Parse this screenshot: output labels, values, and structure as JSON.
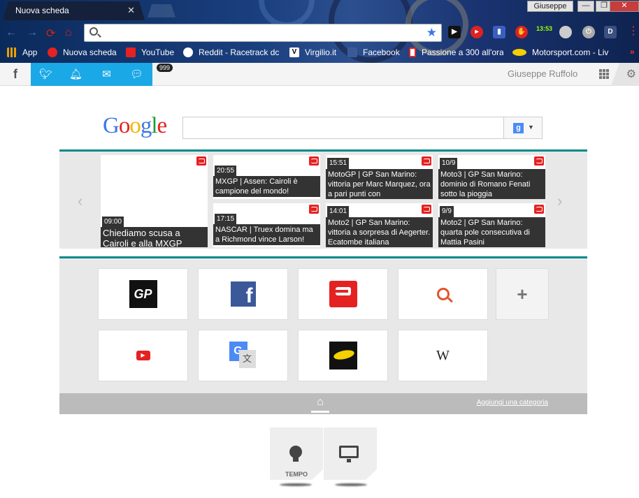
{
  "window": {
    "tab_title": "Nuova scheda",
    "tab_close": "✕",
    "user_button": "Giuseppe",
    "minimize": "—",
    "restore": "❐",
    "close": "✕"
  },
  "toolbar": {
    "address_value": "",
    "ext_clock": "13:53",
    "ext_d": "D"
  },
  "bookmarks": [
    {
      "label": "App",
      "icon": "apps-grid-icon",
      "color": "#e8a100"
    },
    {
      "label": "Nuova scheda",
      "icon": "power-icon",
      "color": "#e52222"
    },
    {
      "label": "YouTube",
      "icon": "youtube-icon",
      "color": "#e52222"
    },
    {
      "label": "Reddit - Racetrack dc",
      "icon": "reddit-icon",
      "color": "#ffffff"
    },
    {
      "label": "Virgilio.it",
      "icon": "virgilio-icon",
      "color": "#222222"
    },
    {
      "label": "Facebook",
      "icon": "facebook-icon",
      "color": "#3b5998"
    },
    {
      "label": "Passione a 300 all'ora",
      "icon": "page-icon",
      "color": "#e52222"
    },
    {
      "label": "Motorsport.com - Liv",
      "icon": "motorsport-icon",
      "color": "#f5d000"
    }
  ],
  "social": {
    "facebook": "f",
    "badge": "999",
    "username": "Giuseppe Ruffolo"
  },
  "google": {
    "logo": [
      "G",
      "o",
      "o",
      "g",
      "l",
      "e"
    ],
    "logo_colors": [
      "#3b78e7",
      "#e52222",
      "#f5b400",
      "#3b78e7",
      "#1a9e3a",
      "#e52222"
    ],
    "button_g": "g"
  },
  "news": [
    {
      "time": "09:00",
      "title": "Chiediamo scusa a Cairoli e alla MXGP"
    },
    {
      "time": "20:55",
      "title": "MXGP | Assen: Cairoli è campione del mondo!"
    },
    {
      "time": "17:15",
      "title": "NASCAR | Truex domina ma a Richmond vince Larson!"
    },
    {
      "time": "15:51",
      "title": "MotoGP | GP San Marino: vittoria per Marc Marquez, ora a pari punti con"
    },
    {
      "time": "14:01",
      "title": "Moto2 | GP San Marino: vittoria a sorpresa di Aegerter. Ecatombe italiana"
    },
    {
      "time": "10/9",
      "title": "Moto3 | GP San Marino: dominio di Romano Fenati sotto la pioggia"
    },
    {
      "time": "9/9",
      "title": "Moto2 | GP San Marino: quarta pole consecutiva di Mattia Pasini"
    }
  ],
  "tiles": {
    "add_label": "+",
    "gp_text": "GP",
    "wiki_text": "W",
    "add_category": "Aggiungi una categoria"
  },
  "widgets": {
    "weather_label": "TEMPO"
  }
}
